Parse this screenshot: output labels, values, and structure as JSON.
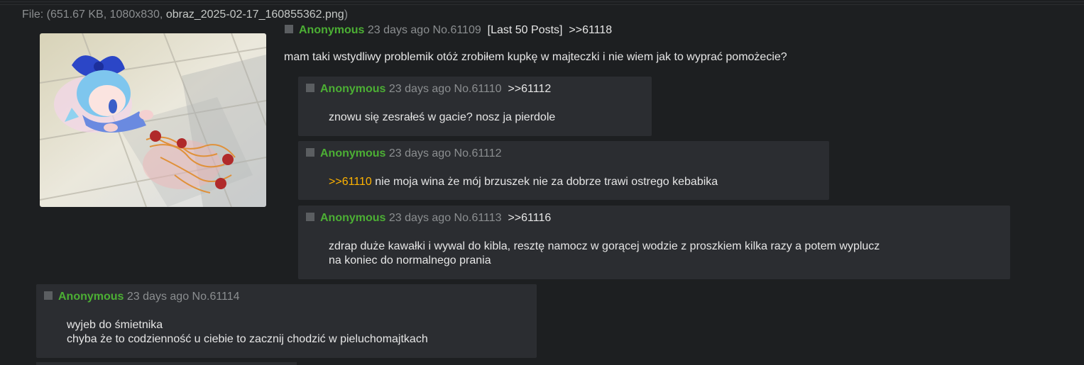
{
  "file": {
    "prefix": "File: (",
    "size": "651.67 KB",
    "sep1": ", ",
    "dimensions": "1080x830",
    "sep2": ", ",
    "filename": "obraz_2025-02-17_160855362.png",
    "suffix": ")"
  },
  "op": {
    "name": "Anonymous",
    "time": "23 days ago",
    "no": "No.61109",
    "last50": "[Last 50 Posts]",
    "backlinks": [
      ">>61118"
    ],
    "body": "mam taki wstydliwy problemik otóż zrobiłem kupkę w majteczki i nie wiem jak to wyprać pomożecie?"
  },
  "replies": [
    {
      "name": "Anonymous",
      "time": "23 days ago",
      "no": "No.61110",
      "backlink": ">>61112",
      "quote": "",
      "lines": [
        "znowu się zesrałeś w gacie? nosz ja pierdole"
      ]
    },
    {
      "name": "Anonymous",
      "time": "23 days ago",
      "no": "No.61112",
      "backlink": "",
      "quote": ">>61110",
      "lines": [
        " nie moja wina że mój brzuszek nie za dobrze trawi ostrego kebabika"
      ]
    },
    {
      "name": "Anonymous",
      "time": "23 days ago",
      "no": "No.61113",
      "backlink": ">>61116",
      "quote": "",
      "lines": [
        "zdrap duże kawałki i wywal do kibla, resztę namocz w gorącej wodzie z proszkiem kilka razy a potem wyplucz",
        "na koniec do normalnego prania"
      ]
    },
    {
      "name": "Anonymous",
      "time": "23 days ago",
      "no": "No.61114",
      "backlink": "",
      "quote": "",
      "lines": [
        "wyjeb do śmietnika",
        "chyba że to codzienność u ciebie to zacznij chodzić w pieluchomajtkach"
      ]
    }
  ],
  "colors": {
    "name": "#4caf34",
    "quotelink": "#ffb300",
    "background": "#1d1f21",
    "post_bg": "#2b2d31"
  }
}
